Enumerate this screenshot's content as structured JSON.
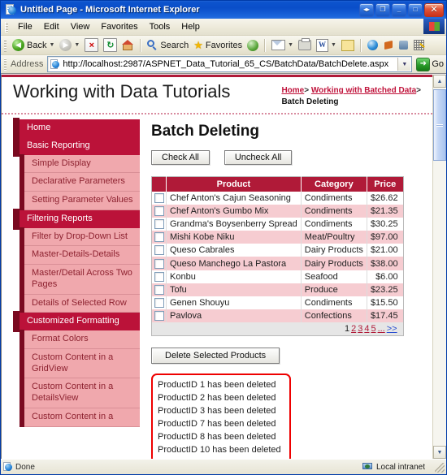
{
  "window": {
    "title": "Untitled Page - Microsoft Internet Explorer",
    "buttons": {
      "restore_group": "◂▸",
      "group": "❐",
      "minimize": "_",
      "maximize": "□",
      "close": "✕"
    }
  },
  "menu": {
    "items": [
      "File",
      "Edit",
      "View",
      "Favorites",
      "Tools",
      "Help"
    ]
  },
  "toolbar": {
    "back_label": "Back",
    "search_label": "Search",
    "favorites_label": "Favorites",
    "icons": [
      "back-icon",
      "forward-icon",
      "stop-icon",
      "refresh-icon",
      "home-icon",
      "search-icon",
      "favorites-star-icon",
      "history-icon",
      "mail-icon",
      "print-icon",
      "edit-word-icon",
      "notes-icon",
      "messenger-icon",
      "msn-icon",
      "research-icon",
      "grid-icon"
    ]
  },
  "address": {
    "label": "Address",
    "url": "http://localhost:2987/ASPNET_Data_Tutorial_65_CS/BatchData/BatchDelete.aspx",
    "go_label": "Go"
  },
  "site": {
    "title": "Working with Data Tutorials",
    "breadcrumb": {
      "home": "Home",
      "sep1": ">",
      "section": "Working with Batched Data",
      "sep2": ">",
      "current": "Batch Deleting"
    }
  },
  "sidebar": {
    "items": [
      {
        "label": "Home",
        "type": "head"
      },
      {
        "label": "Basic Reporting",
        "type": "head"
      },
      {
        "label": "Simple Display",
        "type": "sub"
      },
      {
        "label": "Declarative Parameters",
        "type": "sub"
      },
      {
        "label": "Setting Parameter Values",
        "type": "sub"
      },
      {
        "label": "Filtering Reports",
        "type": "head"
      },
      {
        "label": "Filter by Drop-Down List",
        "type": "sub"
      },
      {
        "label": "Master-Details-Details",
        "type": "sub"
      },
      {
        "label": "Master/Detail Across Two Pages",
        "type": "sub"
      },
      {
        "label": "Details of Selected Row",
        "type": "sub"
      },
      {
        "label": "Customized Formatting",
        "type": "head"
      },
      {
        "label": "Format Colors",
        "type": "sub"
      },
      {
        "label": "Custom Content in a GridView",
        "type": "sub"
      },
      {
        "label": "Custom Content in a DetailsView",
        "type": "sub"
      },
      {
        "label": "Custom Content in a",
        "type": "sub"
      }
    ]
  },
  "main": {
    "page_title": "Batch Deleting",
    "check_all_label": "Check All",
    "uncheck_all_label": "Uncheck All",
    "delete_button_label": "Delete Selected Products",
    "grid": {
      "columns": [
        "",
        "Product",
        "Category",
        "Price"
      ],
      "rows": [
        {
          "product": "Chef Anton's Cajun Seasoning",
          "category": "Condiments",
          "price": "$26.62",
          "checked": false
        },
        {
          "product": "Chef Anton's Gumbo Mix",
          "category": "Condiments",
          "price": "$21.35",
          "checked": false
        },
        {
          "product": "Grandma's Boysenberry Spread",
          "category": "Condiments",
          "price": "$30.25",
          "checked": false
        },
        {
          "product": "Mishi Kobe Niku",
          "category": "Meat/Poultry",
          "price": "$97.00",
          "checked": false
        },
        {
          "product": "Queso Cabrales",
          "category": "Dairy Products",
          "price": "$21.00",
          "checked": false
        },
        {
          "product": "Queso Manchego La Pastora",
          "category": "Dairy Products",
          "price": "$38.00",
          "checked": false
        },
        {
          "product": "Konbu",
          "category": "Seafood",
          "price": "$6.00",
          "checked": false
        },
        {
          "product": "Tofu",
          "category": "Produce",
          "price": "$23.25",
          "checked": false
        },
        {
          "product": "Genen Shouyu",
          "category": "Condiments",
          "price": "$15.50",
          "checked": false
        },
        {
          "product": "Pavlova",
          "category": "Confections",
          "price": "$17.45",
          "checked": false
        }
      ],
      "pager": {
        "current": "1",
        "pages": [
          "2",
          "3",
          "4",
          "5",
          "..."
        ],
        "next": ">>"
      }
    },
    "messages": [
      "ProductID 1 has been deleted",
      "ProductID 2 has been deleted",
      "ProductID 3 has been deleted",
      "ProductID 7 has been deleted",
      "ProductID 8 has been deleted",
      "ProductID 10 has been deleted"
    ]
  },
  "status": {
    "text": "Done",
    "zone": "Local intranet"
  },
  "colors": {
    "brand_red": "#b01a38",
    "nav_head": "#bb1239",
    "nav_sub": "#f0a8ad",
    "accent_dark": "#7a0a20",
    "alt_row": "#f6ccd1",
    "message_border": "#ee0000",
    "link": "#c0143c"
  }
}
